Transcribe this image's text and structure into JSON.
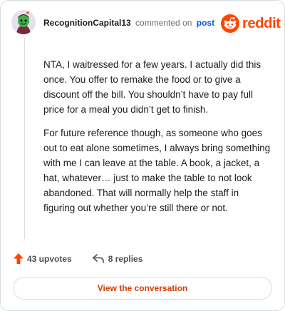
{
  "comment": {
    "username": "RecognitionCapital13",
    "action_text": "commented on",
    "post_link": "post",
    "brand": "reddit",
    "paragraphs": [
      "NTA, I waitressed for a few years. I actually did this once. You offer to remake the food or to give a discount off the bill. You shouldn’t have to pay full price for a meal you didn’t get to finish.",
      "For future reference though, as someone who goes out to eat alone sometimes, I always bring something with me I can leave at the table. A book, a jacket, a hat, whatever… just to make the table to not look abandoned. That will normally help the staff in figuring out whether you’re still there or not."
    ]
  },
  "actions": {
    "upvotes": "43 upvotes",
    "replies": "8 replies"
  },
  "view_conversation_label": "View the conversation",
  "colors": {
    "reddit_orange": "#ff4500",
    "link_blue": "#0a5bd6",
    "button_text": "#d93a00"
  },
  "icons": [
    "avatar",
    "reddit-logo-icon",
    "upvote-arrow-icon",
    "reply-arrow-icon"
  ]
}
